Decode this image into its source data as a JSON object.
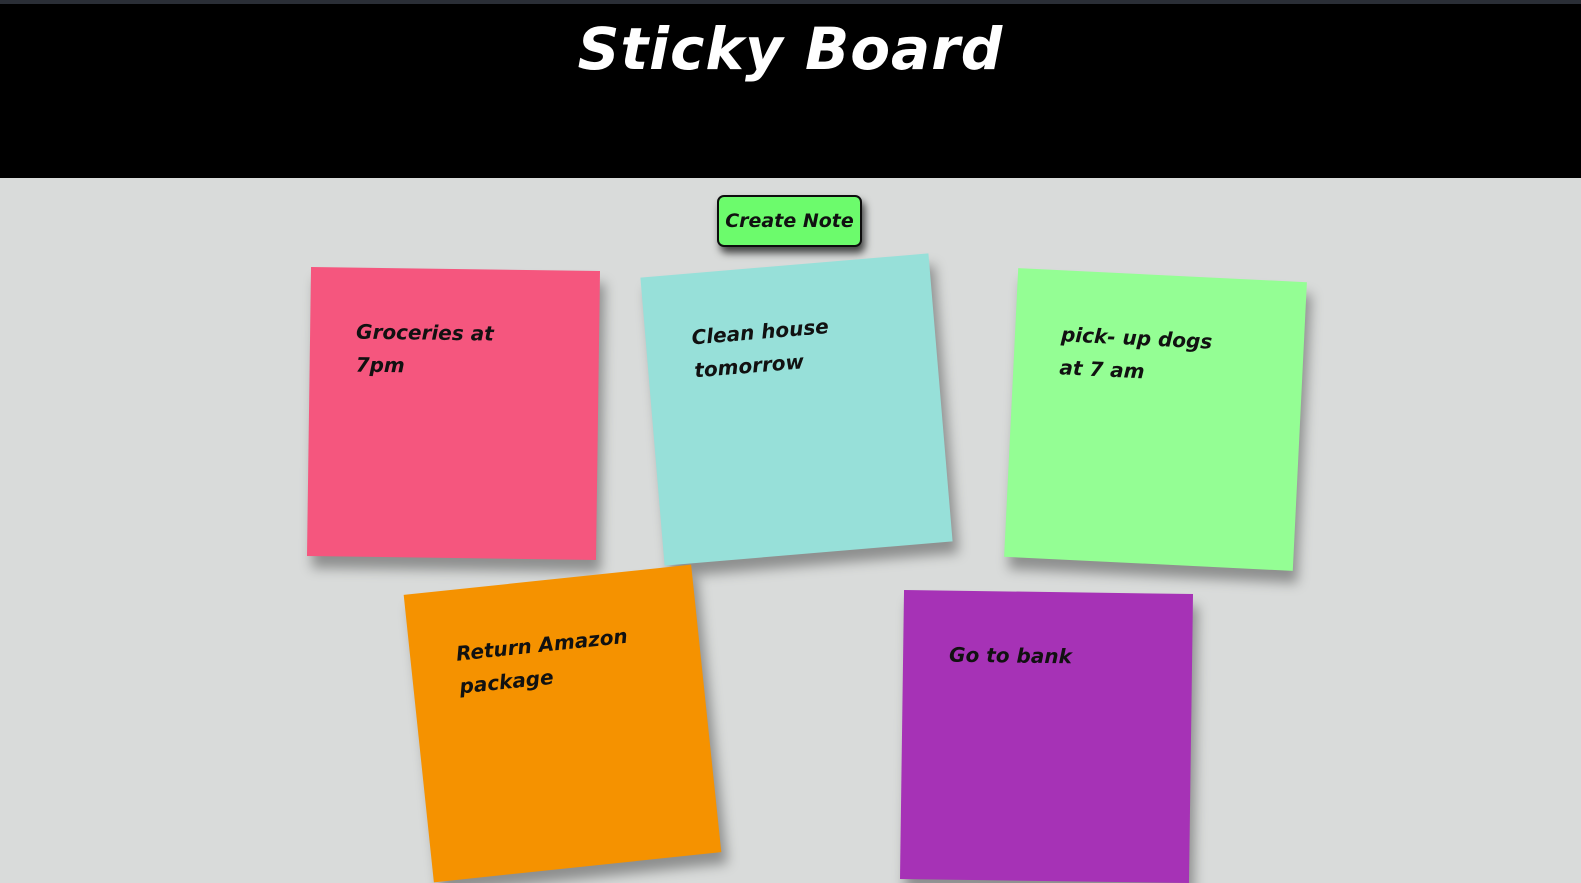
{
  "header": {
    "title": "Sticky Board"
  },
  "toolbar": {
    "create_note_label": "Create Note"
  },
  "notes": [
    {
      "text": "Groceries at 7pm",
      "color": "#f5567e"
    },
    {
      "text": "Clean house tomorrow",
      "color": "#97e0d9"
    },
    {
      "text": "pick- up dogs at 7 am",
      "color": "#94fe94"
    },
    {
      "text": "Return Amazon package",
      "color": "#f59200"
    },
    {
      "text": "Go to bank",
      "color": "#a632b6"
    }
  ],
  "colors": {
    "header_bg": "#000000",
    "board_bg": "#d9dbda",
    "button_bg": "#6cfb6c"
  }
}
